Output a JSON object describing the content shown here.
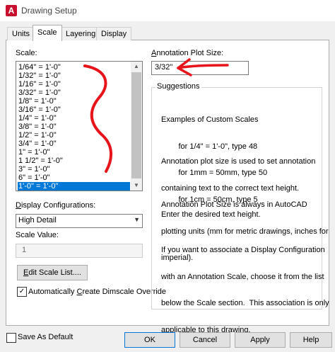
{
  "window": {
    "title": "Drawing Setup",
    "icon_letter": "A"
  },
  "tabs": [
    {
      "label": "Units",
      "active": false
    },
    {
      "label": "Scale",
      "active": true
    },
    {
      "label": "Layering",
      "active": false
    },
    {
      "label": "Display",
      "active": false
    }
  ],
  "scale": {
    "label": "Scale:",
    "items": [
      "1/64\" = 1'-0\"",
      "1/32\" = 1'-0\"",
      "1/16\" = 1'-0\"",
      "3/32\" = 1'-0\"",
      "1/8\" = 1'-0\"",
      "3/16\" = 1'-0\"",
      "1/4\" = 1'-0\"",
      "3/8\" = 1'-0\"",
      "1/2\" = 1'-0\"",
      "3/4\" = 1'-0\"",
      "1\" = 1'-0\"",
      "1 1/2\" = 1'-0\"",
      "3\" = 1'-0\"",
      "6\" = 1'-0\"",
      "1'-0\" = 1'-0\""
    ],
    "selected_index": 14
  },
  "display_config": {
    "label": "Display Configurations:",
    "value": "High Detail"
  },
  "scale_value": {
    "label": "Scale Value:",
    "value": "1"
  },
  "edit_scale_list": {
    "label": "Edit Scale List...."
  },
  "dimscale": {
    "label": "Automatically Create Dimscale Override",
    "checked": true
  },
  "annotation": {
    "label": "Annotation Plot Size:",
    "value": "3/32\""
  },
  "suggestions": {
    "title": "Suggestions",
    "p1": [
      "Examples of Custom Scales",
      "        for 1/4\" = 1'-0\", type 48",
      "        for 1mm = 50mm, type 50",
      "        for 1cm = 50cm, type 5"
    ],
    "p2": [
      "Annotation plot size is used to set annotation",
      "containing text to the correct text height.",
      "Enter the desired text height."
    ],
    "p3": [
      "Annotation Plot Size is always in AutoCAD",
      "plotting units (mm for metric drawings, inches for",
      "imperial)."
    ],
    "p4": [
      "If you want to associate a Display Configuration",
      "with an Annotation Scale, choose it from the list",
      "below the Scale section.  This association is only",
      "applicable to this drawing."
    ]
  },
  "footer": {
    "save_default": {
      "label": "Save As Default",
      "checked": false
    },
    "ok": "OK",
    "cancel": "Cancel",
    "apply": "Apply",
    "help": "Help"
  },
  "colors": {
    "accent": "#0078d7",
    "annotation_ink": "#e8141b",
    "autocad_red": "#c8102e"
  }
}
